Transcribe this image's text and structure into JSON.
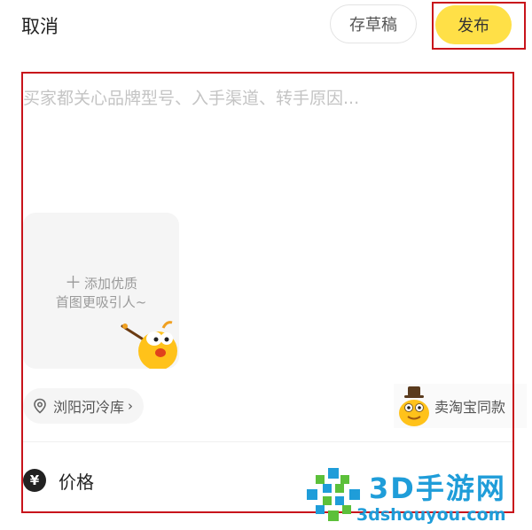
{
  "topbar": {
    "cancel_label": "取消",
    "draft_label": "存草稿",
    "publish_label": "发布"
  },
  "editor": {
    "description_placeholder": "买家都关心品牌型号、入手渠道、转手原因..."
  },
  "photo_picker": {
    "line1": "添加优质",
    "line2": "首图更吸引人~",
    "plus_icon": "plus-icon",
    "mascot_icon": "mascot-bird-icon"
  },
  "location": {
    "label": "浏阳河冷库",
    "icon": "location-pin-icon"
  },
  "same_item": {
    "label": "卖淘宝同款",
    "icon": "top-hat-bird-icon"
  },
  "price": {
    "label": "价格",
    "icon_glyph": "¥"
  },
  "watermark": {
    "title": "3D手游网",
    "url": "3dshouyou.com"
  },
  "colors": {
    "accent_yellow": "#ffe047",
    "highlight_red": "#c8141b",
    "watermark_blue": "#1f9dd9",
    "watermark_green": "#5cc03a"
  }
}
